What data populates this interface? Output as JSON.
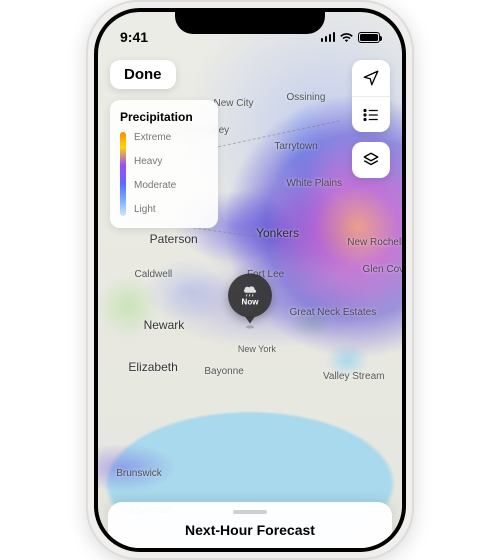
{
  "status_bar": {
    "time": "9:41"
  },
  "done_label": "Done",
  "legend": {
    "title": "Precipitation",
    "levels": [
      "Extreme",
      "Heavy",
      "Moderate",
      "Light"
    ]
  },
  "center_pin": {
    "label": "Now"
  },
  "bottom_sheet": {
    "title": "Next-Hour Forecast"
  },
  "map": {
    "cities": {
      "new_city": "New City",
      "ossining": "Ossining",
      "spring_valley": "Spring Valley",
      "tarrytown": "Tarrytown",
      "white_plains": "White Plains",
      "paterson": "Paterson",
      "yonkers": "Yonkers",
      "new_rochelle": "New Rochelle",
      "caldwell": "Caldwell",
      "fort_lee": "Fort Lee",
      "glen_cove": "Glen Cove",
      "newark": "Newark",
      "great_neck": "Great Neck Estates",
      "elizabeth": "Elizabeth",
      "bayonne": "Bayonne",
      "new_york": "New York",
      "valley_stream": "Valley Stream",
      "brunswick": "Brunswick",
      "sayreville": "Sayreville"
    }
  }
}
